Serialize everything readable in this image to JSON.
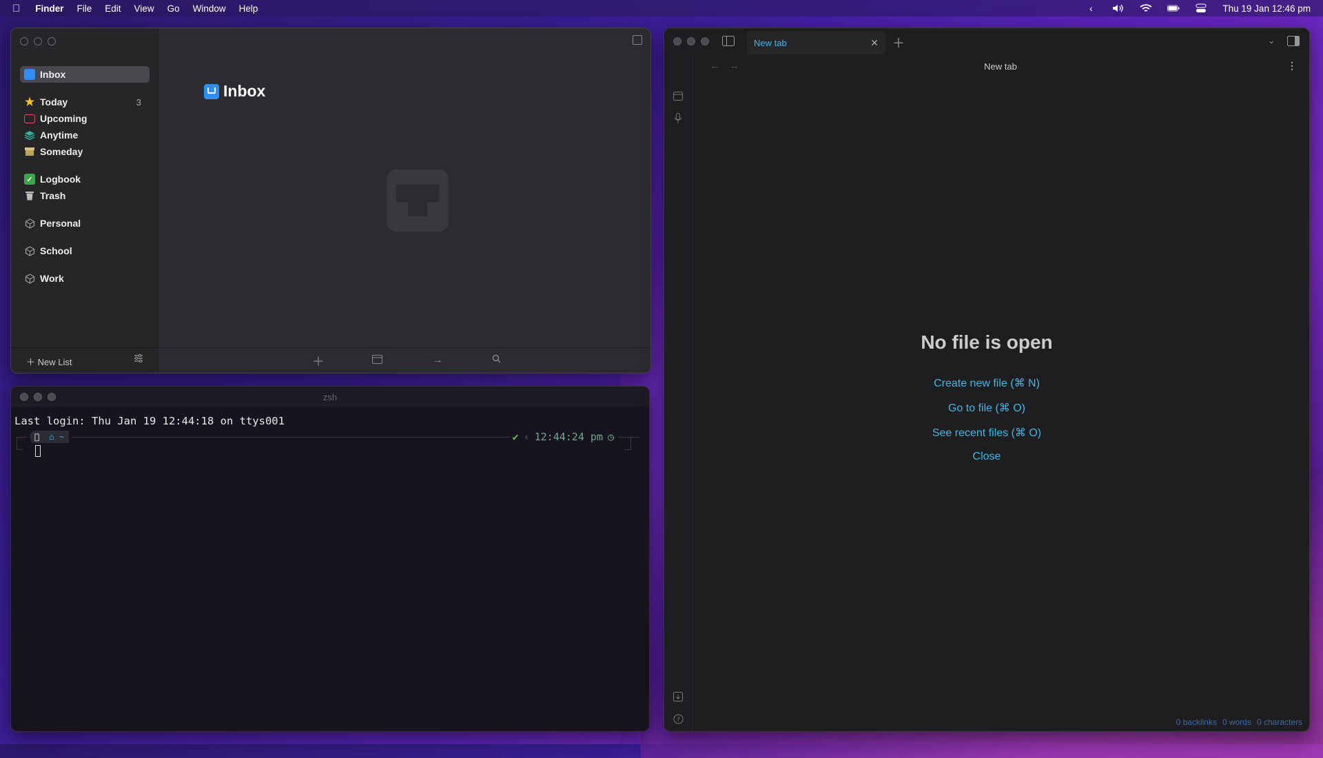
{
  "menubar": {
    "app": "Finder",
    "items": [
      "File",
      "Edit",
      "View",
      "Go",
      "Window",
      "Help"
    ],
    "clock": "Thu 19 Jan  12:46 pm"
  },
  "things": {
    "sidebar": {
      "inbox": "Inbox",
      "today": "Today",
      "today_count": "3",
      "upcoming": "Upcoming",
      "anytime": "Anytime",
      "someday": "Someday",
      "logbook": "Logbook",
      "trash": "Trash",
      "areas": [
        "Personal",
        "School",
        "Work"
      ],
      "new_list": "New List"
    },
    "main_title": "Inbox",
    "colors": {
      "inbox": "#2e8ff0",
      "today": "#f6c226",
      "upcoming": "#e8486a",
      "anytime": "#34b39a",
      "someday": "#d9c27a",
      "logbook": "#3aa84a"
    }
  },
  "terminal": {
    "title": "zsh",
    "last_login": "Last login: Thu Jan 19 12:44:18 on ttys001",
    "prompt_dir": "~",
    "prompt_status": "✔",
    "prompt_time": "12:44:24 pm"
  },
  "obsidian": {
    "tab_label": "New tab",
    "header_title": "New tab",
    "empty_title": "No file is open",
    "links": [
      "Create new file (⌘ N)",
      "Go to file (⌘ O)",
      "See recent files (⌘ O)",
      "Close"
    ],
    "status": [
      "0 backlinks",
      "0 words",
      "0 characters"
    ],
    "accent": "#3fb8e8"
  }
}
